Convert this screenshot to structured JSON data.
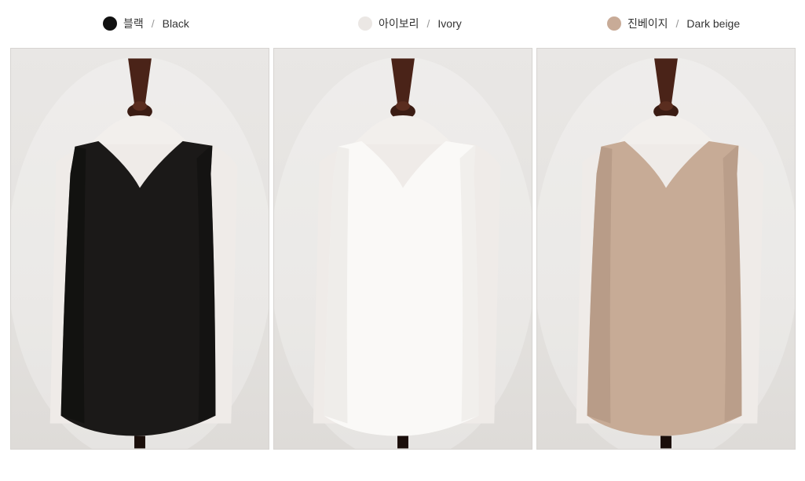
{
  "variants": [
    {
      "kr": "블랙",
      "sep": "/",
      "en": "Black",
      "swatch_color": "#111111",
      "garment_color": "#1b1918",
      "garment_shade": "#0e0d0c"
    },
    {
      "kr": "아이보리",
      "sep": "/",
      "en": "Ivory",
      "swatch_color": "#ebe7e4",
      "garment_color": "#faf9f7",
      "garment_shade": "#e7e5e1"
    },
    {
      "kr": "진베이지",
      "sep": "/",
      "en": "Dark beige",
      "swatch_color": "#c8ab97",
      "garment_color": "#c7ab96",
      "garment_shade": "#ad927e"
    }
  ]
}
